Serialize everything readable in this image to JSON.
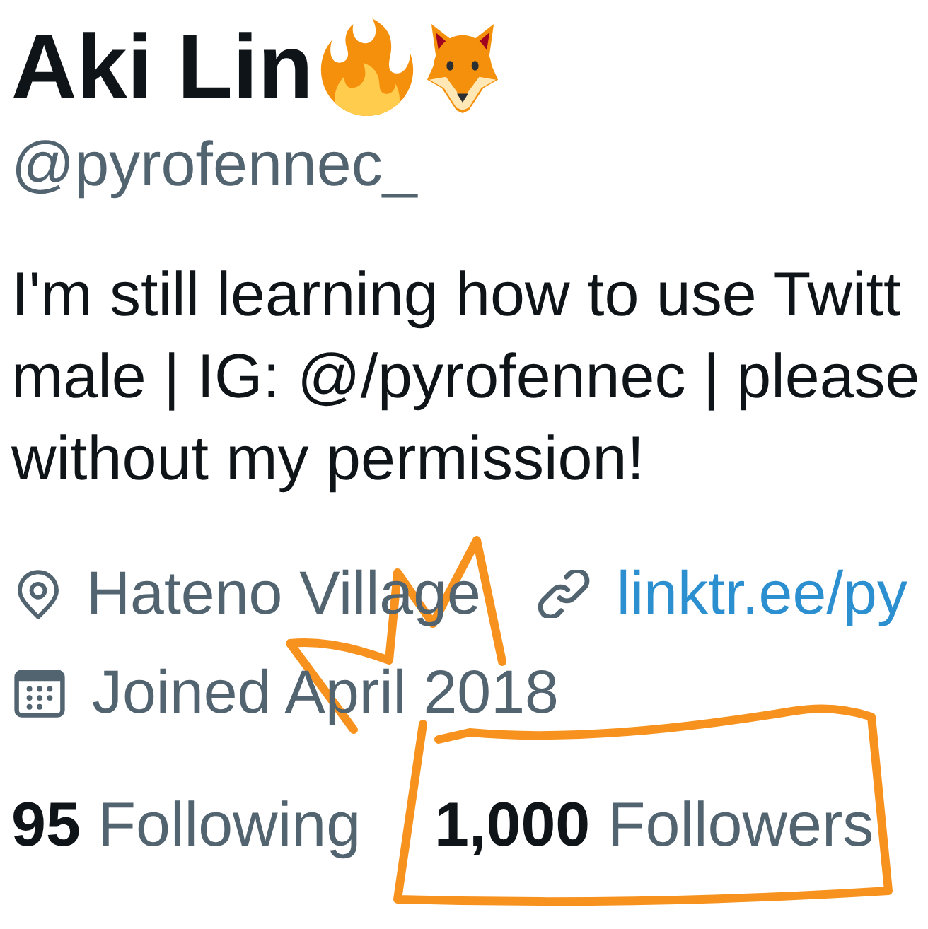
{
  "profile": {
    "display_name": "Aki Lin",
    "handle": "@pyrofennec_",
    "bio": "I'm still learning how to use Twitt\nmale | IG: @/pyrofennec | please\nwithout my permission!",
    "details": [
      [
        {
          "kind": "location",
          "text": "Hateno Village"
        },
        {
          "kind": "link",
          "text": "linktr.ee/py"
        }
      ],
      [
        {
          "kind": "joined",
          "text": "Joined April 2018"
        }
      ]
    ],
    "stats": [
      {
        "count": "95",
        "label": "Following"
      },
      {
        "count": "1,000",
        "label": "Followers"
      }
    ]
  }
}
